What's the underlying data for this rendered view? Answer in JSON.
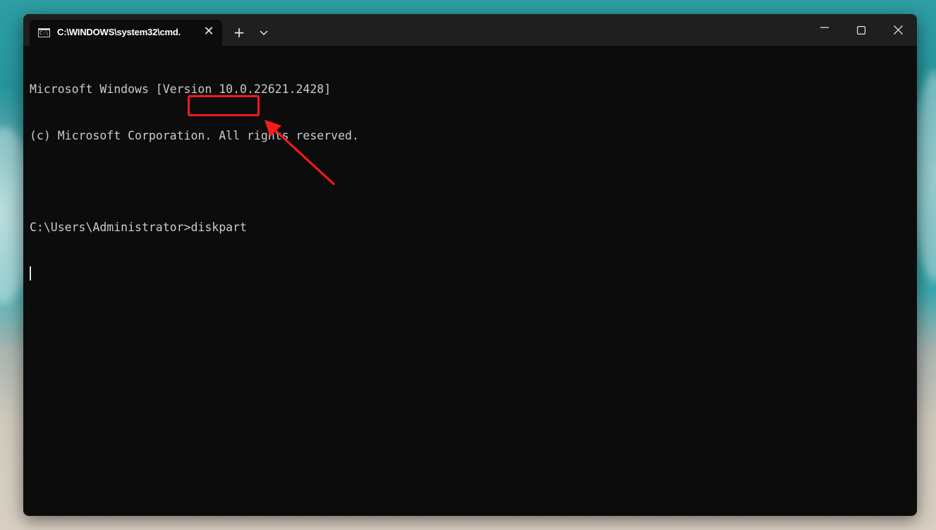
{
  "window": {
    "tab_title": "C:\\WINDOWS\\system32\\cmd.",
    "tab_icon": "cmd-icon",
    "new_tab_label": "+",
    "close_tab_label": "✕",
    "controls": [
      "minimize-icon",
      "maximize-icon",
      "close-icon"
    ]
  },
  "terminal": {
    "lines": [
      "Microsoft Windows [Version 10.0.22621.2428]",
      "(c) Microsoft Corporation. All rights reserved.",
      "",
      "C:\\Users\\Administrator>diskpart"
    ]
  },
  "annotation": {
    "highlight_color": "#ff1a1a",
    "highlight_target": "diskpart command",
    "arrow_icon": "red-arrow-icon"
  }
}
